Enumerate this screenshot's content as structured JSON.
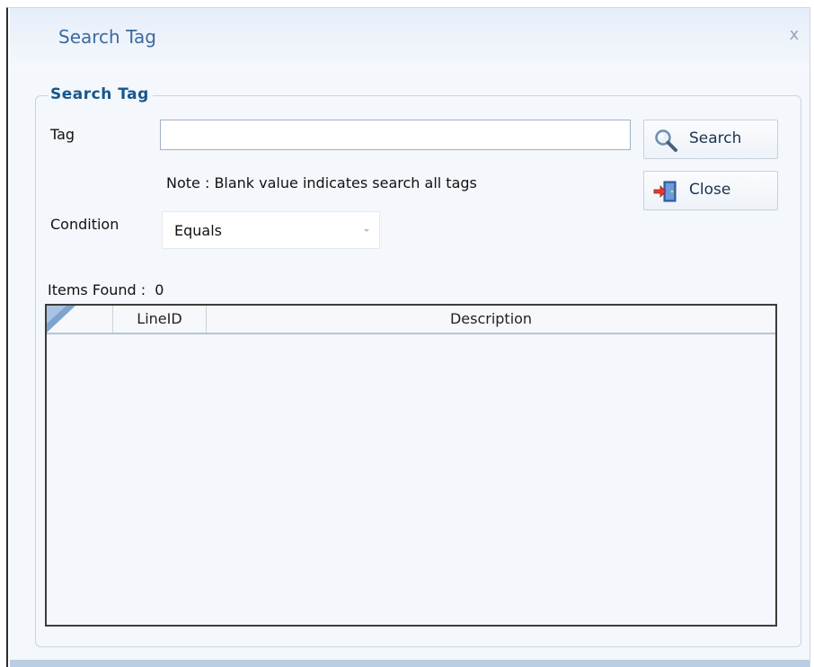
{
  "dialog": {
    "title": "Search Tag",
    "close_glyph": "x"
  },
  "group": {
    "legend": "Search Tag"
  },
  "tag": {
    "label": "Tag",
    "value": "",
    "placeholder": ""
  },
  "note": "Note : Blank value indicates search all tags",
  "condition": {
    "label": "Condition",
    "selected": "Equals"
  },
  "buttons": {
    "search": {
      "label": "Search",
      "icon": "magnifier-icon"
    },
    "close": {
      "label": "Close",
      "icon": "exit-door-icon"
    }
  },
  "results": {
    "count_label": "Items Found :",
    "count": "0"
  },
  "grid": {
    "columns": [
      "LineID",
      "Description"
    ],
    "rows": []
  },
  "colors": {
    "title": "#3c6aa0",
    "legend": "#16578e",
    "body_bg": "#f4f7fb",
    "titlebar_bg": "#e6eefb"
  }
}
